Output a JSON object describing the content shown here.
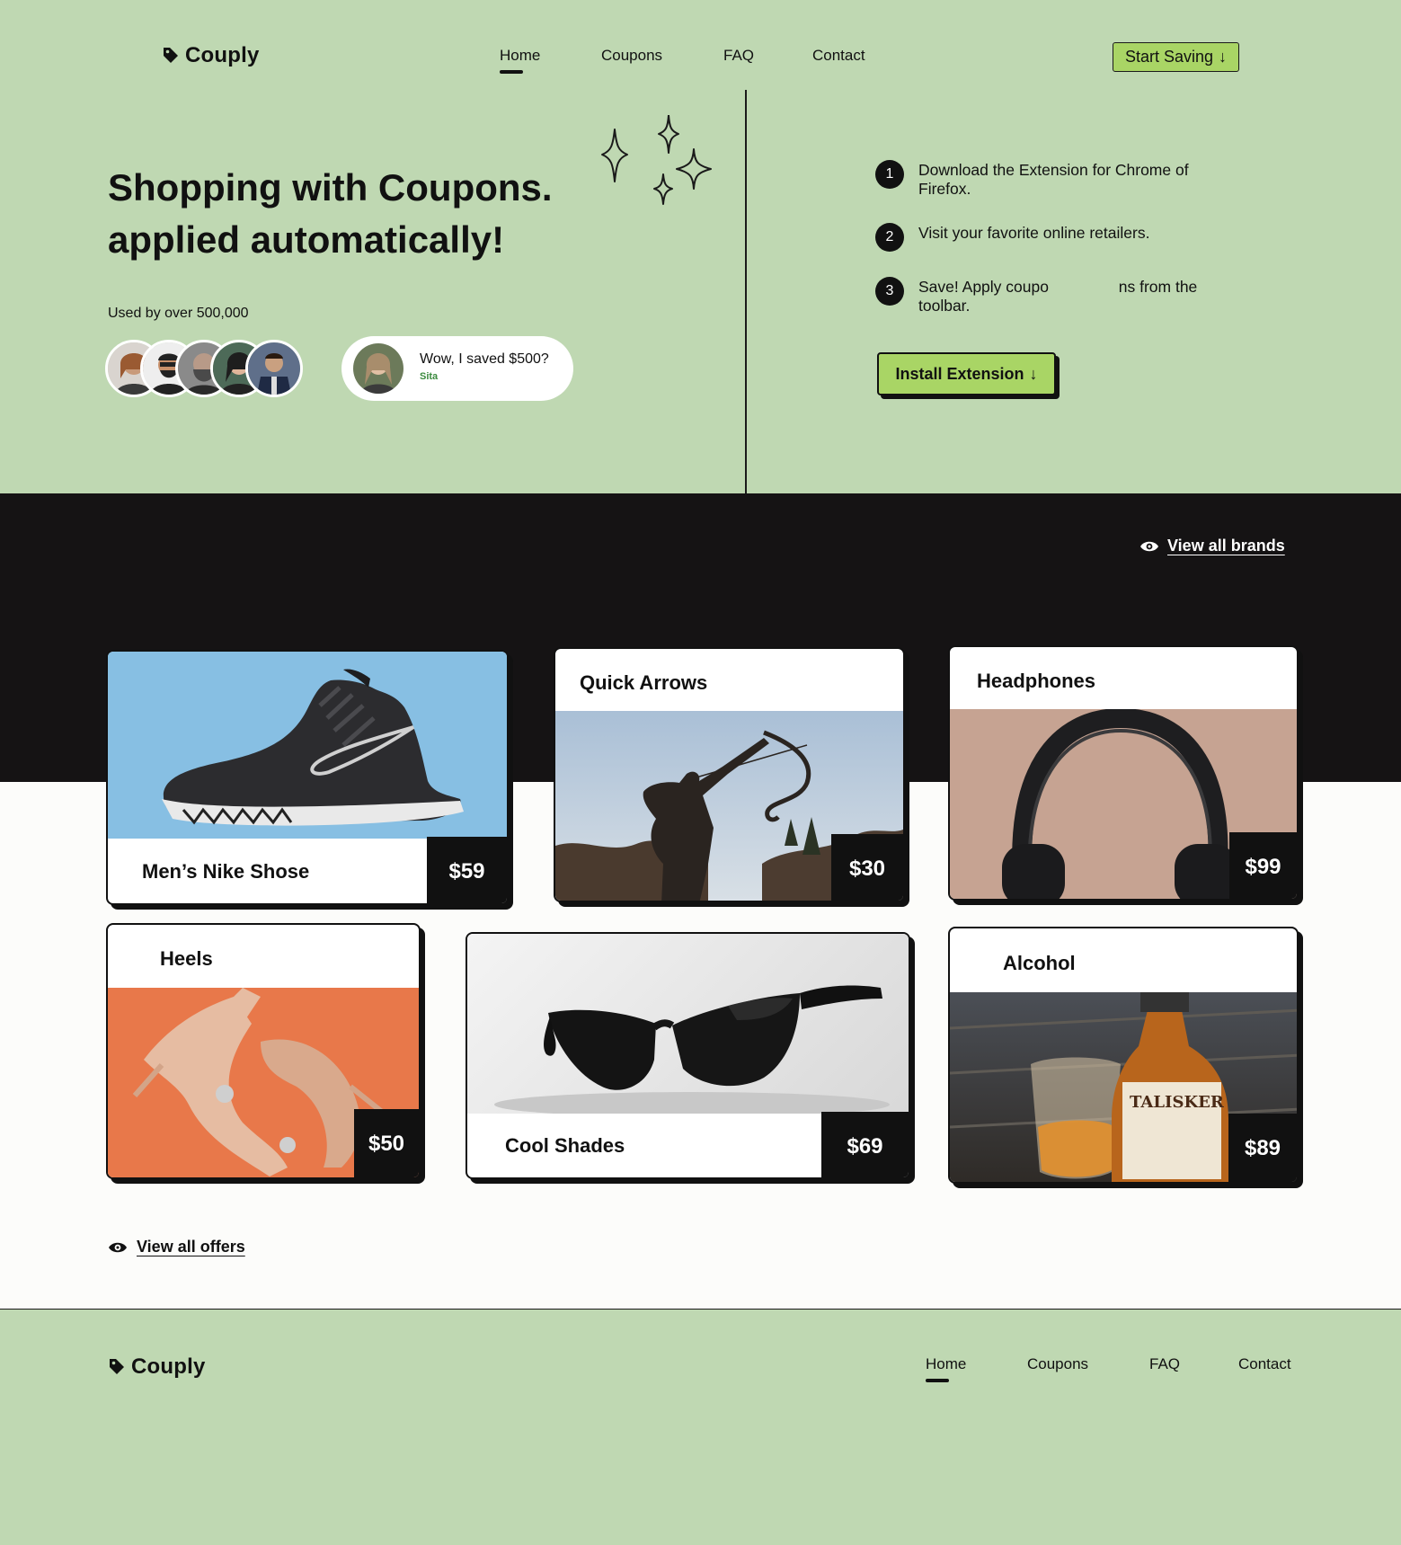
{
  "brand": {
    "name": "Couply"
  },
  "colors": {
    "accent": "#a9d565",
    "mint_bg": "#bfd8b2",
    "dark": "#151314",
    "testimonial_name": "#3c8b3f"
  },
  "nav": {
    "items": [
      {
        "label": "Home",
        "active": true
      },
      {
        "label": "Coupons",
        "active": false
      },
      {
        "label": "FAQ",
        "active": false
      },
      {
        "label": "Contact",
        "active": false
      }
    ],
    "cta_label": "Start Saving",
    "cta_icon": "arrow-down-icon"
  },
  "hero": {
    "title_line1": "Shopping with Coupons.",
    "title_line2": "applied automatically!",
    "used_by": "Used by over 500,000",
    "testimonial": {
      "quote": "Wow, I saved $500?",
      "name": "Sita"
    },
    "steps": [
      {
        "number": "1",
        "text": "Download the Extension for Chrome of Firefox."
      },
      {
        "number": "2",
        "text": "Visit your favorite online retailers."
      },
      {
        "number": "3",
        "text": "Save! Apply coupo                ns from the toolbar."
      }
    ],
    "install_label": "Install Extension"
  },
  "brands_link": "View all brands",
  "offers": [
    {
      "title": "Men’s Nike Shose",
      "price": "$59",
      "image": "sneaker"
    },
    {
      "title": "Quick Arrows",
      "price": "$30",
      "image": "archer-statue"
    },
    {
      "title": "Headphones",
      "price": "$99",
      "image": "headphones"
    },
    {
      "title": "Heels",
      "price": "$50",
      "image": "heels"
    },
    {
      "title": "Cool Shades",
      "price": "$69",
      "image": "sunglasses"
    },
    {
      "title": "Alcohol",
      "price": "$89",
      "image": "whisky"
    }
  ],
  "offers_link": "View all offers",
  "footer": {
    "brand": "Couply",
    "nav": [
      "Home",
      "Coupons",
      "FAQ",
      "Contact"
    ]
  }
}
